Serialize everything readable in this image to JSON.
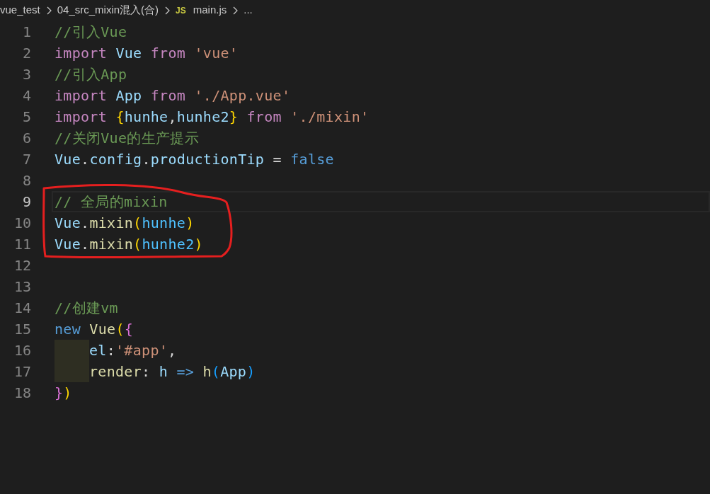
{
  "breadcrumb": [
    {
      "label": "vue_test"
    },
    {
      "label": "04_src_mixin混入(合)"
    },
    {
      "label": "main.js",
      "icon_text": "JS"
    },
    {
      "label": "..."
    }
  ],
  "editor": {
    "lines": [
      {
        "number": "1",
        "current": false,
        "indented": false,
        "tokens": [
          {
            "kind": "comment",
            "text": "//引入Vue"
          }
        ]
      },
      {
        "number": "2",
        "current": false,
        "indented": false,
        "tokens": [
          {
            "kind": "keyword",
            "text": "import"
          },
          {
            "kind": "variable",
            "text": " Vue"
          },
          {
            "kind": "keyword",
            "text": " from"
          },
          {
            "kind": "string",
            "text": " 'vue'"
          }
        ]
      },
      {
        "number": "3",
        "current": false,
        "indented": false,
        "tokens": [
          {
            "kind": "comment",
            "text": "//引入App"
          }
        ]
      },
      {
        "number": "4",
        "current": false,
        "indented": false,
        "tokens": [
          {
            "kind": "keyword",
            "text": "import"
          },
          {
            "kind": "variable",
            "text": " App"
          },
          {
            "kind": "keyword",
            "text": " from"
          },
          {
            "kind": "string",
            "text": " './App.vue'"
          }
        ]
      },
      {
        "number": "5",
        "current": false,
        "indented": false,
        "tokens": [
          {
            "kind": "keyword",
            "text": "import"
          },
          {
            "kind": "bracket1",
            "text": " {"
          },
          {
            "kind": "variable",
            "text": "hunhe"
          },
          {
            "kind": "plain",
            "text": ","
          },
          {
            "kind": "variable",
            "text": "hunhe2"
          },
          {
            "kind": "bracket1",
            "text": "}"
          },
          {
            "kind": "keyword",
            "text": " from"
          },
          {
            "kind": "string",
            "text": " './mixin'"
          }
        ]
      },
      {
        "number": "6",
        "current": false,
        "indented": false,
        "tokens": [
          {
            "kind": "comment",
            "text": "//关闭Vue的生产提示"
          }
        ]
      },
      {
        "number": "7",
        "current": false,
        "indented": false,
        "tokens": [
          {
            "kind": "variable",
            "text": "Vue"
          },
          {
            "kind": "plain",
            "text": "."
          },
          {
            "kind": "variable",
            "text": "config"
          },
          {
            "kind": "plain",
            "text": "."
          },
          {
            "kind": "variable",
            "text": "productionTip"
          },
          {
            "kind": "plain",
            "text": " ="
          },
          {
            "kind": "constant",
            "text": " false"
          }
        ]
      },
      {
        "number": "8",
        "current": false,
        "indented": false
      },
      {
        "number": "9",
        "current": true,
        "indented": false,
        "tokens": [
          {
            "kind": "comment",
            "text": "// 全局的mixin"
          }
        ]
      },
      {
        "number": "10",
        "current": false,
        "indented": false,
        "tokens": [
          {
            "kind": "variable",
            "text": "Vue"
          },
          {
            "kind": "plain",
            "text": "."
          },
          {
            "kind": "function",
            "text": "mixin"
          },
          {
            "kind": "bracket1",
            "text": "("
          },
          {
            "kind": "constant_var",
            "text": "hunhe"
          },
          {
            "kind": "bracket1",
            "text": ")"
          }
        ]
      },
      {
        "number": "11",
        "current": false,
        "indented": false,
        "tokens": [
          {
            "kind": "variable",
            "text": "Vue"
          },
          {
            "kind": "plain",
            "text": "."
          },
          {
            "kind": "function",
            "text": "mixin"
          },
          {
            "kind": "bracket1",
            "text": "("
          },
          {
            "kind": "constant_var",
            "text": "hunhe2"
          },
          {
            "kind": "bracket1",
            "text": ")"
          }
        ]
      },
      {
        "number": "12",
        "current": false,
        "indented": false
      },
      {
        "number": "13",
        "current": false,
        "indented": false
      },
      {
        "number": "14",
        "current": false,
        "indented": false,
        "tokens": [
          {
            "kind": "comment",
            "text": "//创建vm"
          }
        ]
      },
      {
        "number": "15",
        "current": false,
        "indented": false,
        "tokens": [
          {
            "kind": "constant",
            "text": "new"
          },
          {
            "kind": "function",
            "text": " Vue"
          },
          {
            "kind": "bracket1",
            "text": "("
          },
          {
            "kind": "bracket2",
            "text": "{"
          }
        ]
      },
      {
        "number": "16",
        "current": false,
        "indented": true,
        "tokens": [
          {
            "kind": "variable",
            "text": "el"
          },
          {
            "kind": "plain",
            "text": ":"
          },
          {
            "kind": "string",
            "text": "'#app'"
          },
          {
            "kind": "plain",
            "text": ","
          }
        ]
      },
      {
        "number": "17",
        "current": false,
        "indented": true,
        "tokens": [
          {
            "kind": "function",
            "text": "render"
          },
          {
            "kind": "plain",
            "text": ":"
          },
          {
            "kind": "variable",
            "text": " h"
          },
          {
            "kind": "constant",
            "text": " =>"
          },
          {
            "kind": "function",
            "text": " h"
          },
          {
            "kind": "bracket3",
            "text": "("
          },
          {
            "kind": "variable",
            "text": "App"
          },
          {
            "kind": "bracket3",
            "text": ")"
          }
        ]
      },
      {
        "number": "18",
        "current": false,
        "indented": false,
        "tokens": [
          {
            "kind": "bracket2",
            "text": "}"
          },
          {
            "kind": "bracket1",
            "text": ")"
          }
        ]
      }
    ]
  }
}
